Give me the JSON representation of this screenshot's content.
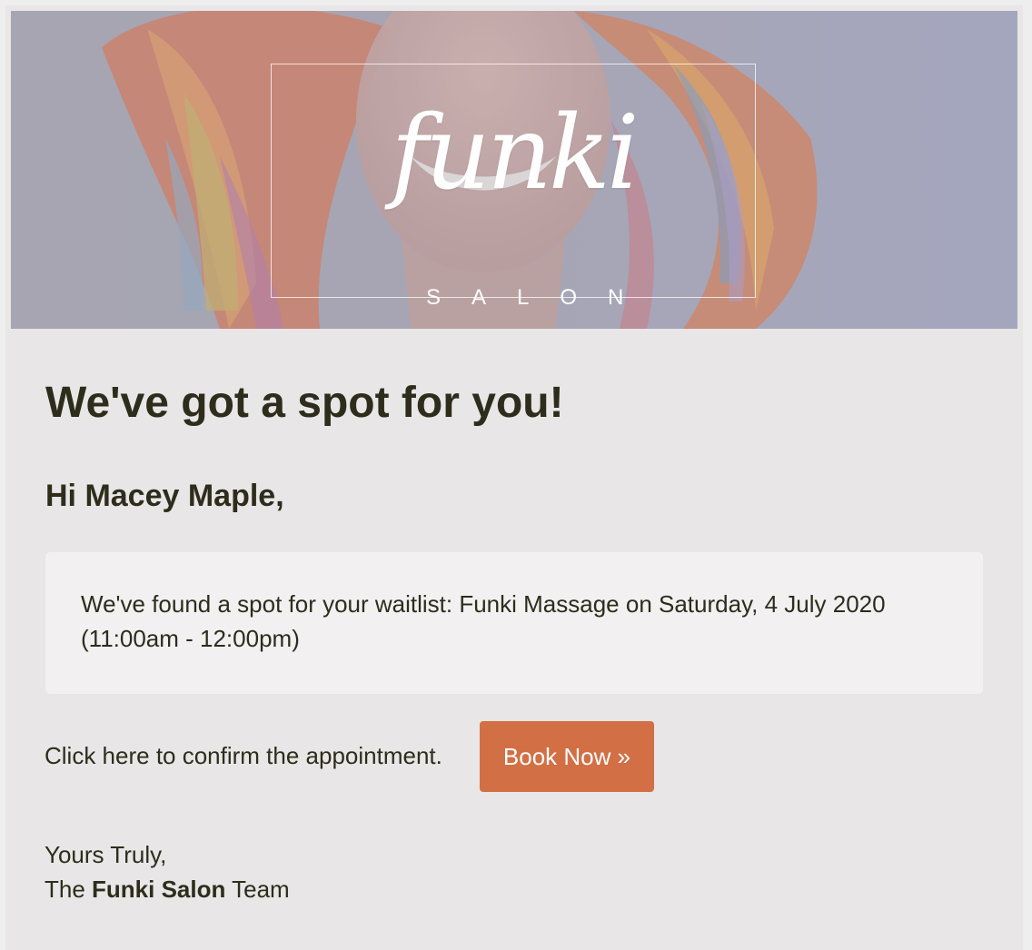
{
  "banner": {
    "logo_script": "funki",
    "logo_subtitle": "SALON",
    "overlay_color": "#a3a5bd"
  },
  "headline": "We've got a spot for you!",
  "greeting": "Hi Macey Maple,",
  "notice": {
    "text": "We've found a spot for your waitlist: Funki Massage on Saturday, 4 July 2020 (11:00am - 12:00pm)"
  },
  "confirm": {
    "text": "Click here to confirm the appointment.",
    "button_label": "Book Now »",
    "button_color": "#d26f45"
  },
  "signoff": {
    "line1": "Yours Truly,",
    "prefix": "The ",
    "brand": "Funki Salon",
    "suffix": " Team"
  },
  "colors": {
    "text": "#2e2c1b",
    "background": "#e8e6e6",
    "card": "#f2f0f1"
  }
}
